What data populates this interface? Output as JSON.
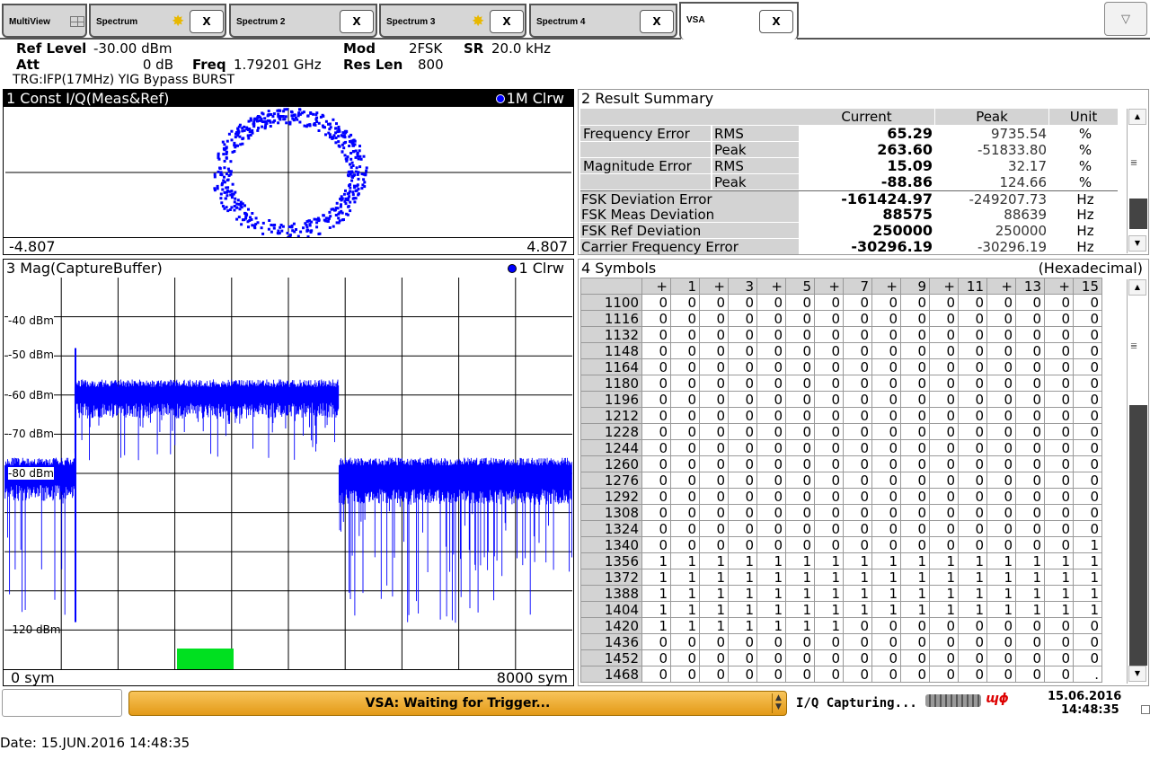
{
  "tabs": [
    {
      "label": "MultiView"
    },
    {
      "label": "Spectrum",
      "close": "X"
    },
    {
      "label": "Spectrum 2",
      "close": "X"
    },
    {
      "label": "Spectrum 3",
      "close": "X"
    },
    {
      "label": "Spectrum 4",
      "close": "X"
    },
    {
      "label": "VSA",
      "close": "X"
    }
  ],
  "tab_menu": "▽",
  "header": {
    "ref_level_label": "Ref Level",
    "ref_level_value": "-30.00 dBm",
    "att_label": "Att",
    "att_value": "0 dB",
    "freq_label": "Freq",
    "freq_value": "1.79201 GHz",
    "mod_label": "Mod",
    "mod_value": "2FSK",
    "sr_label": "SR",
    "sr_value": "20.0 kHz",
    "reslen_label": "Res Len",
    "reslen_value": "800",
    "trigger": "TRG:IFP(17MHz) YIG Bypass BURST"
  },
  "const_panel": {
    "title": "1 Const I/Q(Meas&Ref)",
    "trace": "1M Clrw",
    "xmin": "-4.807",
    "xmax": "4.807"
  },
  "mag_panel": {
    "title": "3 Mag(CaptureBuffer)",
    "trace": "1 Clrw",
    "xmin": "0 sym",
    "xmax": "8000 sym",
    "y_ticks": [
      "-40 dBm",
      "-50 dBm",
      "-60 dBm",
      "-70 dBm",
      "-80 dBm",
      "-120 dBm"
    ]
  },
  "result_summary": {
    "title": "2 Result Summary",
    "headers": [
      "Current",
      "Peak",
      "Unit"
    ],
    "rows": [
      {
        "name": "Frequency Error",
        "sub": "RMS",
        "current": "65.29",
        "peak": "9735.54",
        "unit": "%"
      },
      {
        "name": "",
        "sub": "Peak",
        "current": "263.60",
        "peak": "-51833.80",
        "unit": "%"
      },
      {
        "name": "Magnitude Error",
        "sub": "RMS",
        "current": "15.09",
        "peak": "32.17",
        "unit": "%"
      },
      {
        "name": "",
        "sub": "Peak",
        "current": "-88.86",
        "peak": "124.66",
        "unit": "%"
      },
      {
        "name": "FSK Deviation Error",
        "sub": "",
        "current": "-161424.97",
        "peak": "-249207.73",
        "unit": "Hz"
      },
      {
        "name": "FSK Meas Deviation",
        "sub": "",
        "current": "88575",
        "peak": "88639",
        "unit": "Hz"
      },
      {
        "name": "FSK Ref Deviation",
        "sub": "",
        "current": "250000",
        "peak": "250000",
        "unit": "Hz"
      },
      {
        "name": "Carrier Frequency Error",
        "sub": "",
        "current": "-30296.19",
        "peak": "-30296.19",
        "unit": "Hz"
      }
    ]
  },
  "symbols": {
    "title": "4 Symbols",
    "format": "(Hexadecimal)",
    "columns": [
      "+",
      "1",
      "+",
      "3",
      "+",
      "5",
      "+",
      "7",
      "+",
      "9",
      "+",
      "11",
      "+",
      "13",
      "+",
      "15"
    ],
    "rows": [
      {
        "label": "1100",
        "values": [
          "0",
          "0",
          "0",
          "0",
          "0",
          "0",
          "0",
          "0",
          "0",
          "0",
          "0",
          "0",
          "0",
          "0",
          "0",
          "0"
        ]
      },
      {
        "label": "1116",
        "values": [
          "0",
          "0",
          "0",
          "0",
          "0",
          "0",
          "0",
          "0",
          "0",
          "0",
          "0",
          "0",
          "0",
          "0",
          "0",
          "0"
        ]
      },
      {
        "label": "1132",
        "values": [
          "0",
          "0",
          "0",
          "0",
          "0",
          "0",
          "0",
          "0",
          "0",
          "0",
          "0",
          "0",
          "0",
          "0",
          "0",
          "0"
        ]
      },
      {
        "label": "1148",
        "values": [
          "0",
          "0",
          "0",
          "0",
          "0",
          "0",
          "0",
          "0",
          "0",
          "0",
          "0",
          "0",
          "0",
          "0",
          "0",
          "0"
        ]
      },
      {
        "label": "1164",
        "values": [
          "0",
          "0",
          "0",
          "0",
          "0",
          "0",
          "0",
          "0",
          "0",
          "0",
          "0",
          "0",
          "0",
          "0",
          "0",
          "0"
        ]
      },
      {
        "label": "1180",
        "values": [
          "0",
          "0",
          "0",
          "0",
          "0",
          "0",
          "0",
          "0",
          "0",
          "0",
          "0",
          "0",
          "0",
          "0",
          "0",
          "0"
        ]
      },
      {
        "label": "1196",
        "values": [
          "0",
          "0",
          "0",
          "0",
          "0",
          "0",
          "0",
          "0",
          "0",
          "0",
          "0",
          "0",
          "0",
          "0",
          "0",
          "0"
        ]
      },
      {
        "label": "1212",
        "values": [
          "0",
          "0",
          "0",
          "0",
          "0",
          "0",
          "0",
          "0",
          "0",
          "0",
          "0",
          "0",
          "0",
          "0",
          "0",
          "0"
        ]
      },
      {
        "label": "1228",
        "values": [
          "0",
          "0",
          "0",
          "0",
          "0",
          "0",
          "0",
          "0",
          "0",
          "0",
          "0",
          "0",
          "0",
          "0",
          "0",
          "0"
        ]
      },
      {
        "label": "1244",
        "values": [
          "0",
          "0",
          "0",
          "0",
          "0",
          "0",
          "0",
          "0",
          "0",
          "0",
          "0",
          "0",
          "0",
          "0",
          "0",
          "0"
        ]
      },
      {
        "label": "1260",
        "values": [
          "0",
          "0",
          "0",
          "0",
          "0",
          "0",
          "0",
          "0",
          "0",
          "0",
          "0",
          "0",
          "0",
          "0",
          "0",
          "0"
        ]
      },
      {
        "label": "1276",
        "values": [
          "0",
          "0",
          "0",
          "0",
          "0",
          "0",
          "0",
          "0",
          "0",
          "0",
          "0",
          "0",
          "0",
          "0",
          "0",
          "0"
        ]
      },
      {
        "label": "1292",
        "values": [
          "0",
          "0",
          "0",
          "0",
          "0",
          "0",
          "0",
          "0",
          "0",
          "0",
          "0",
          "0",
          "0",
          "0",
          "0",
          "0"
        ]
      },
      {
        "label": "1308",
        "values": [
          "0",
          "0",
          "0",
          "0",
          "0",
          "0",
          "0",
          "0",
          "0",
          "0",
          "0",
          "0",
          "0",
          "0",
          "0",
          "0"
        ]
      },
      {
        "label": "1324",
        "values": [
          "0",
          "0",
          "0",
          "0",
          "0",
          "0",
          "0",
          "0",
          "0",
          "0",
          "0",
          "0",
          "0",
          "0",
          "0",
          "0"
        ]
      },
      {
        "label": "1340",
        "values": [
          "0",
          "0",
          "0",
          "0",
          "0",
          "0",
          "0",
          "0",
          "0",
          "0",
          "0",
          "0",
          "0",
          "0",
          "0",
          "1"
        ]
      },
      {
        "label": "1356",
        "values": [
          "1",
          "1",
          "1",
          "1",
          "1",
          "1",
          "1",
          "1",
          "1",
          "1",
          "1",
          "1",
          "1",
          "1",
          "1",
          "1"
        ]
      },
      {
        "label": "1372",
        "values": [
          "1",
          "1",
          "1",
          "1",
          "1",
          "1",
          "1",
          "1",
          "1",
          "1",
          "1",
          "1",
          "1",
          "1",
          "1",
          "1"
        ]
      },
      {
        "label": "1388",
        "values": [
          "1",
          "1",
          "1",
          "1",
          "1",
          "1",
          "1",
          "1",
          "1",
          "1",
          "1",
          "1",
          "1",
          "1",
          "1",
          "1"
        ]
      },
      {
        "label": "1404",
        "values": [
          "1",
          "1",
          "1",
          "1",
          "1",
          "1",
          "1",
          "1",
          "1",
          "1",
          "1",
          "1",
          "1",
          "1",
          "1",
          "1"
        ]
      },
      {
        "label": "1420",
        "values": [
          "1",
          "1",
          "1",
          "1",
          "1",
          "1",
          "1",
          "0",
          "0",
          "0",
          "0",
          "0",
          "0",
          "0",
          "0",
          "0"
        ]
      },
      {
        "label": "1436",
        "values": [
          "0",
          "0",
          "0",
          "0",
          "0",
          "0",
          "0",
          "0",
          "0",
          "0",
          "0",
          "0",
          "0",
          "0",
          "0",
          "0"
        ]
      },
      {
        "label": "1452",
        "values": [
          "0",
          "0",
          "0",
          "0",
          "0",
          "0",
          "0",
          "0",
          "0",
          "0",
          "0",
          "0",
          "0",
          "0",
          "0",
          "0"
        ]
      },
      {
        "label": "1468",
        "values": [
          "0",
          "0",
          "0",
          "0",
          "0",
          "0",
          "0",
          "0",
          "0",
          "0",
          "0",
          "0",
          "0",
          "0",
          "0",
          "."
        ]
      }
    ]
  },
  "status": {
    "message": "VSA: Waiting for Trigger...",
    "capture": "I/Q Capturing...",
    "date": "15.06.2016",
    "time": "14:48:35"
  },
  "footer": "Date: 15.JUN.2016  14:48:35",
  "colors": {
    "trace": "#0000ff",
    "accent": "#f0a830",
    "marker": "#00e020"
  }
}
